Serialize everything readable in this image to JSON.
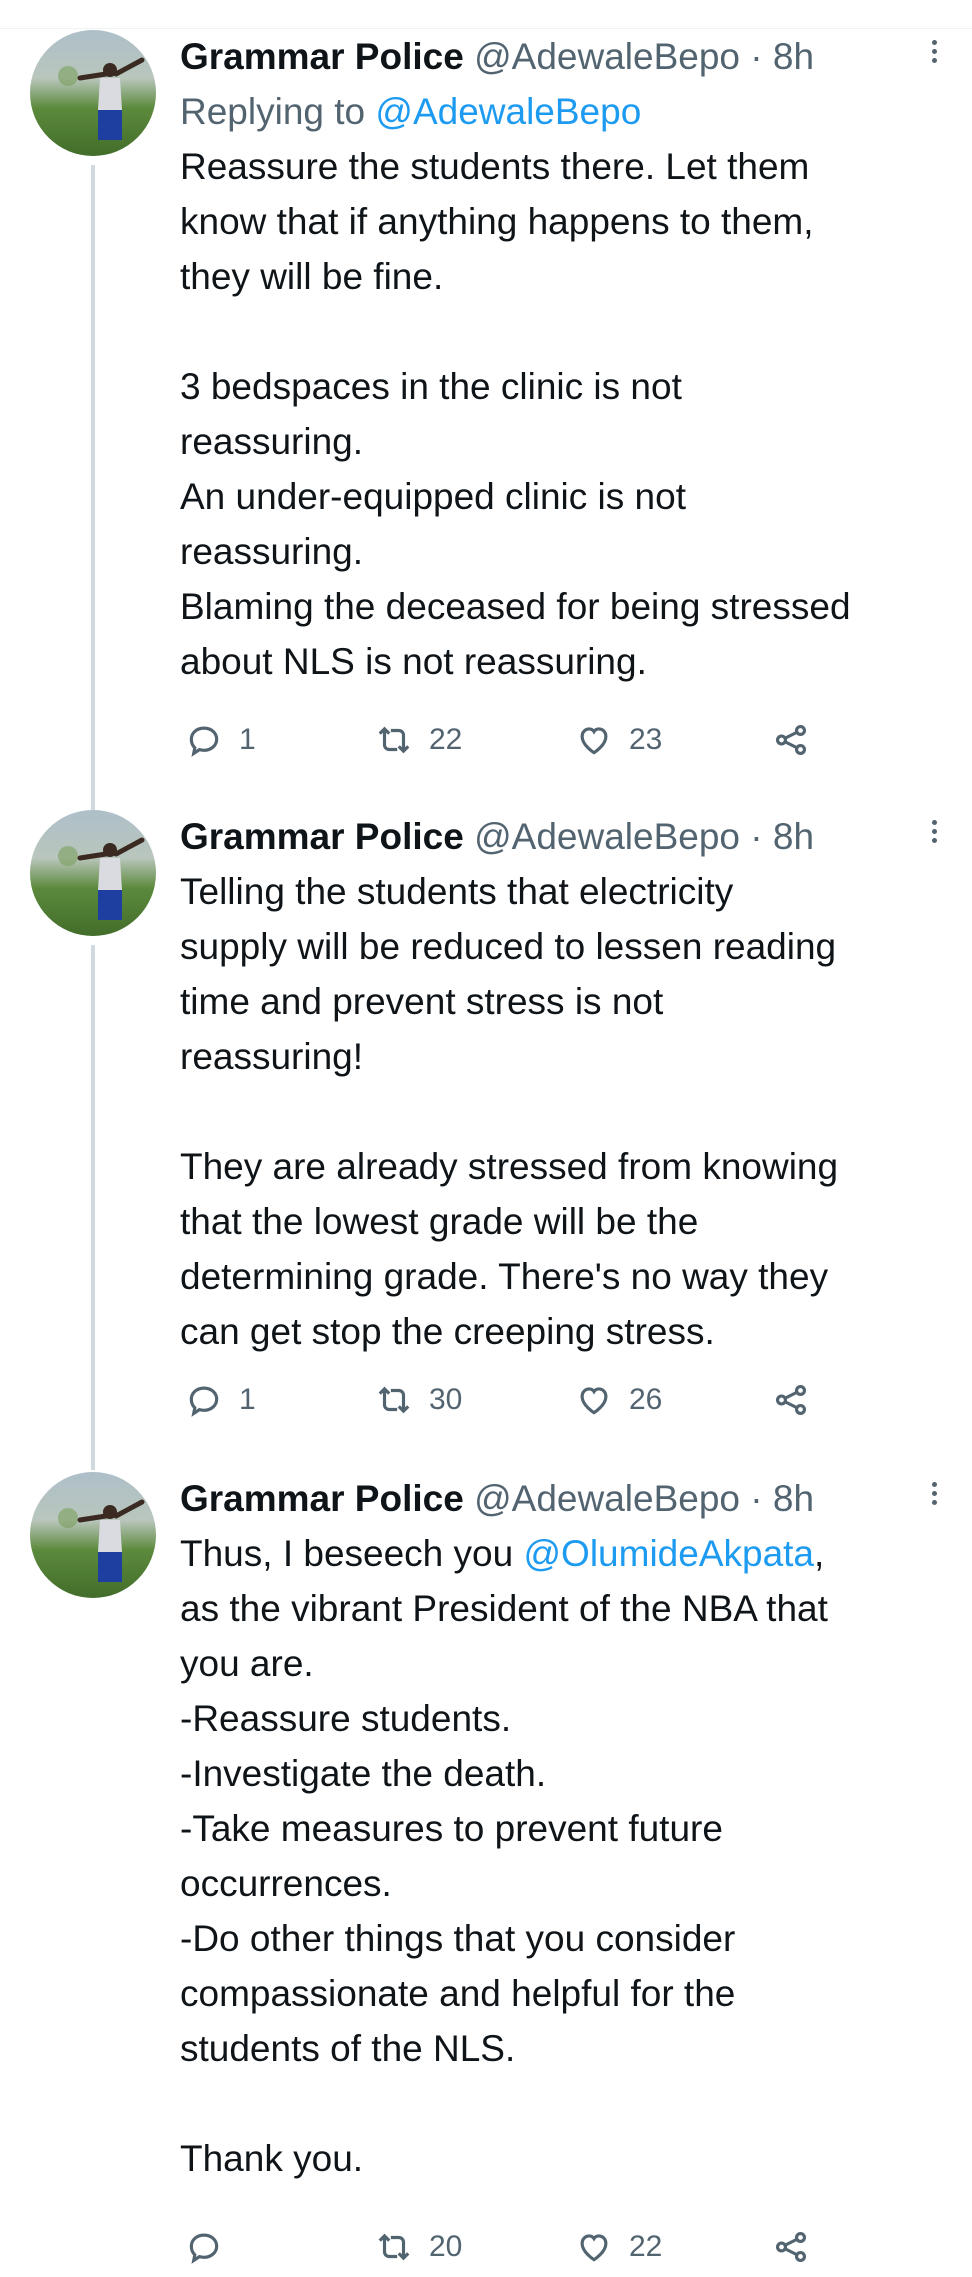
{
  "tweets": [
    {
      "name": "Grammar Police",
      "handle": "@AdewaleBepo",
      "sep": " · ",
      "time": "8h",
      "replying_prefix": "Replying to ",
      "replying_to": "@AdewaleBepo",
      "text": "Reassure the students there. Let them\nknow that if anything happens to them,\nthey will be fine.\n\n3 bedspaces in the clinic is not\nreassuring.\nAn under-equipped clinic is not\nreassuring.\nBlaming the deceased for being stressed\nabout NLS is not reassuring.",
      "replies": "1",
      "retweets": "22",
      "likes": "23"
    },
    {
      "name": "Grammar Police",
      "handle": "@AdewaleBepo",
      "sep": " · ",
      "time": "8h",
      "text": "Telling the students that electricity\nsupply will be reduced to lessen reading\ntime and prevent stress is not\nreassuring!\n\nThey are already stressed from knowing\nthat the lowest grade will be the\ndetermining grade. There's no way they\ncan get stop the creeping stress.",
      "replies": "1",
      "retweets": "30",
      "likes": "26"
    },
    {
      "name": "Grammar Police",
      "handle": "@AdewaleBepo",
      "sep": " · ",
      "time": "8h",
      "text_before_mention": "Thus, I beseech you ",
      "mention": "@OlumideAkpata",
      "text_after_mention": ",\nas the vibrant President of the NBA that\nyou are.\n-Reassure students.\n-Investigate the death.\n-Take measures to prevent future\noccurrences.\n-Do other things that you consider\ncompassionate and helpful for the\nstudents of the NLS.\n\nThank you.",
      "replies": "",
      "retweets": "20",
      "likes": "22"
    }
  ],
  "icons": {
    "reply": "reply-icon",
    "retweet": "retweet-icon",
    "like": "heart-icon",
    "share": "share-icon",
    "more": "more-vertical-icon"
  },
  "colors": {
    "link": "#1d9bf0",
    "secondary_text": "#536471",
    "thread_line": "#cfd9de"
  }
}
